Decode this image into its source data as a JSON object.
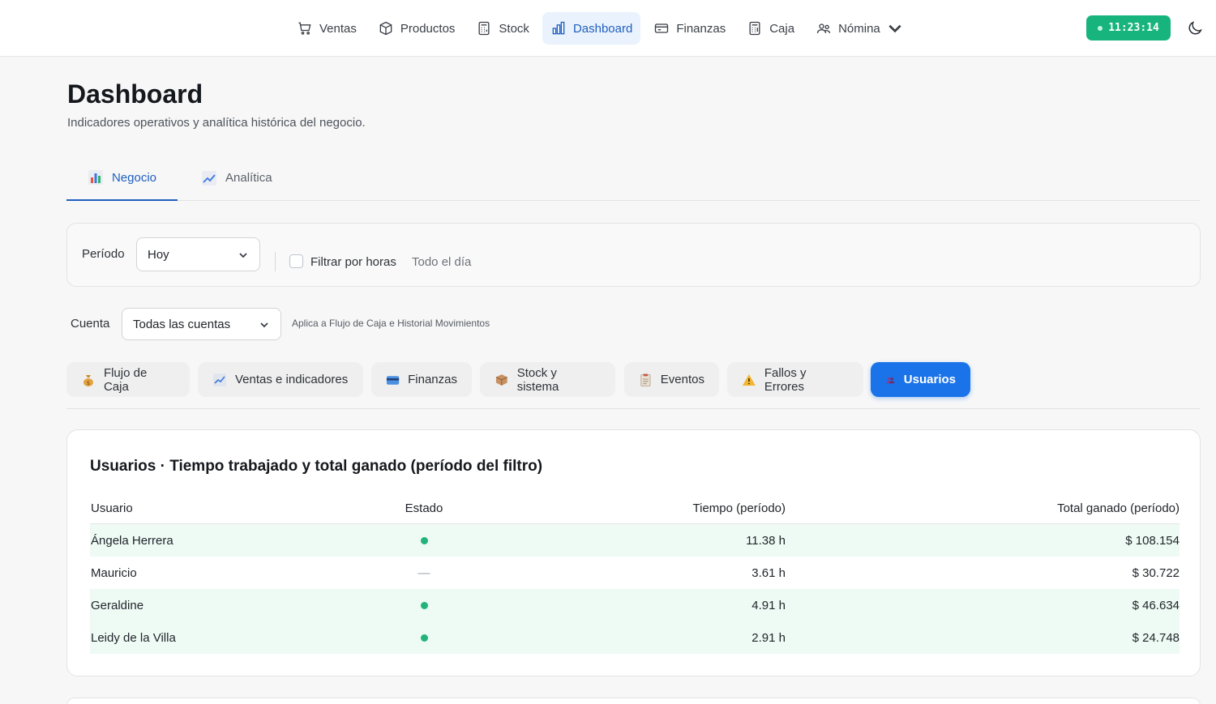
{
  "nav": {
    "items": [
      {
        "label": "Ventas",
        "icon": "cart-icon"
      },
      {
        "label": "Productos",
        "icon": "box-icon"
      },
      {
        "label": "Stock",
        "icon": "calculator-icon"
      },
      {
        "label": "Dashboard",
        "icon": "bar-chart-icon",
        "active": true
      },
      {
        "label": "Finanzas",
        "icon": "card-icon"
      },
      {
        "label": "Caja",
        "icon": "calculator-icon"
      },
      {
        "label": "Nómina",
        "icon": "users-icon",
        "dropdown": true
      }
    ],
    "clock": "11:23:14",
    "theme_icon": "moon-icon"
  },
  "header": {
    "title": "Dashboard",
    "subtitle": "Indicadores operativos y analítica histórica del negocio."
  },
  "main_tabs": [
    {
      "label": "Negocio",
      "active": true
    },
    {
      "label": "Analítica",
      "active": false
    }
  ],
  "filters": {
    "period_label": "Período",
    "period_value": "Hoy",
    "hours_label": "Filtrar por horas",
    "hours_value": "Todo el día",
    "account_label": "Cuenta",
    "account_value": "Todas las cuentas",
    "account_hint": "Aplica a Flujo de Caja e Historial Movimientos"
  },
  "sections": [
    {
      "label": "Flujo de Caja",
      "icon": "money-bag-icon"
    },
    {
      "label": "Ventas e indicadores",
      "icon": "chart-up-icon"
    },
    {
      "label": "Finanzas",
      "icon": "credit-card-icon"
    },
    {
      "label": "Stock y sistema",
      "icon": "package-icon"
    },
    {
      "label": "Eventos",
      "icon": "clipboard-icon"
    },
    {
      "label": "Fallos y Errores",
      "icon": "warning-icon"
    },
    {
      "label": "Usuarios",
      "icon": "people-icon",
      "active": true
    }
  ],
  "users": {
    "title": "Usuarios · Tiempo trabajado y total ganado (período del filtro)",
    "columns": [
      "Usuario",
      "Estado",
      "Tiempo (período)",
      "Total ganado (período)"
    ],
    "rows": [
      {
        "name": "Ángela Herrera",
        "state": "active",
        "time": "11.38 h",
        "total": "$ 108.154"
      },
      {
        "name": "Mauricio",
        "state": "—",
        "time": "3.61 h",
        "total": "$ 30.722"
      },
      {
        "name": "Geraldine",
        "state": "active",
        "time": "4.91 h",
        "total": "$ 46.634"
      },
      {
        "name": "Leidy de la Villa",
        "state": "active",
        "time": "2.91 h",
        "total": "$ 24.748"
      }
    ]
  },
  "colors": {
    "accent": "#1a73e8",
    "clock_bg": "#18b47e",
    "active_dot": "#22b37a",
    "row_highlight": "#eefaf4"
  }
}
